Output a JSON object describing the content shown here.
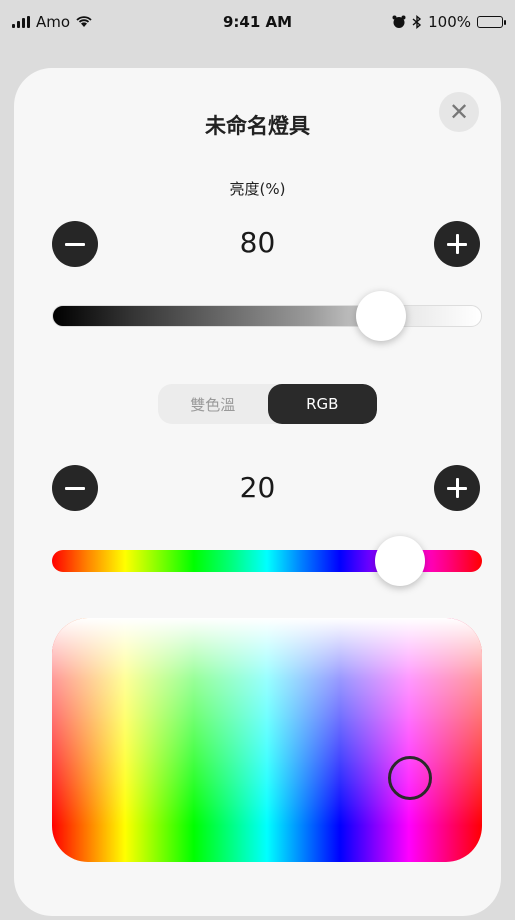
{
  "status_bar": {
    "carrier": "Amo",
    "time": "9:41 AM",
    "battery": "100%"
  },
  "modal": {
    "title": "未命名燈具",
    "close_icon": "close-icon"
  },
  "brightness": {
    "label": "亮度(%)",
    "value": "80",
    "level_percent": 80
  },
  "mode_toggle": {
    "options": [
      "雙色溫",
      "RGB"
    ],
    "selected": "RGB"
  },
  "hue": {
    "value": "20",
    "level_percent": 85
  },
  "colors": {
    "sheet_bg": "#f7f7f7",
    "button_dark": "#262626",
    "segment_selected": "#2a2a2a"
  }
}
